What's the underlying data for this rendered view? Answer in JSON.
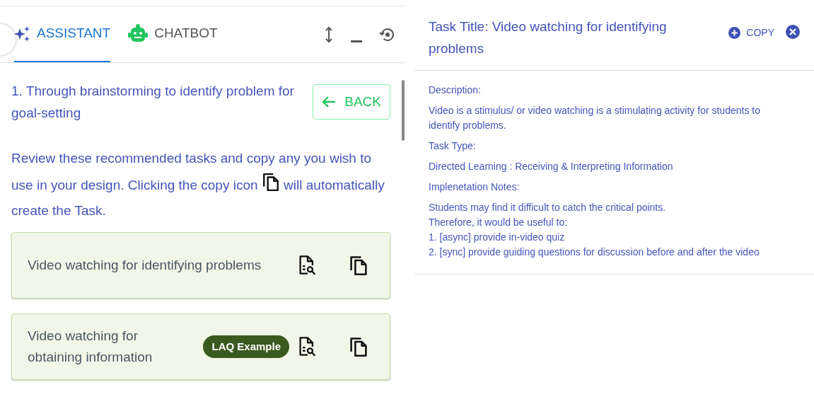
{
  "assistant_panel": {
    "tabs": [
      {
        "label": "ASSISTANT",
        "kind": "sparkle",
        "selected": true
      },
      {
        "label": "CHATBOT",
        "kind": "robot",
        "selected": false
      }
    ],
    "step_title": "1. Through brainstorming to identify problem for goal-setting",
    "back_button": "BACK",
    "instructions_before_icon": "Review these recommended tasks and copy any you wish to use in your design. Clicking the copy icon",
    "instructions_after_icon": "will automatically create the Task.",
    "tasks": [
      {
        "title": "Video watching for identifying problems"
      },
      {
        "title": "Video watching for obtaining information",
        "badge": "LAQ Example"
      }
    ]
  },
  "task_detail": {
    "title": "Task Title: Video watching for identifying problems",
    "copy_button": "COPY",
    "sections": [
      {
        "label": "Description:",
        "lines": [
          "Video is a stimulus/ or video watching is a stimulating activity for students to identify problems."
        ]
      },
      {
        "label": "Task Type:",
        "lines": [
          "Directed Learning : Receiving & Interpreting Information"
        ]
      },
      {
        "label": "Implenetation Notes:",
        "lines": [
          "Students may find it difficult to catch the critical points.",
          "Therefore, it would be useful to:",
          "1. [async] provide in-video quiz",
          "2. [sync] provide guiding questions for discussion before and after the video"
        ]
      }
    ]
  }
}
